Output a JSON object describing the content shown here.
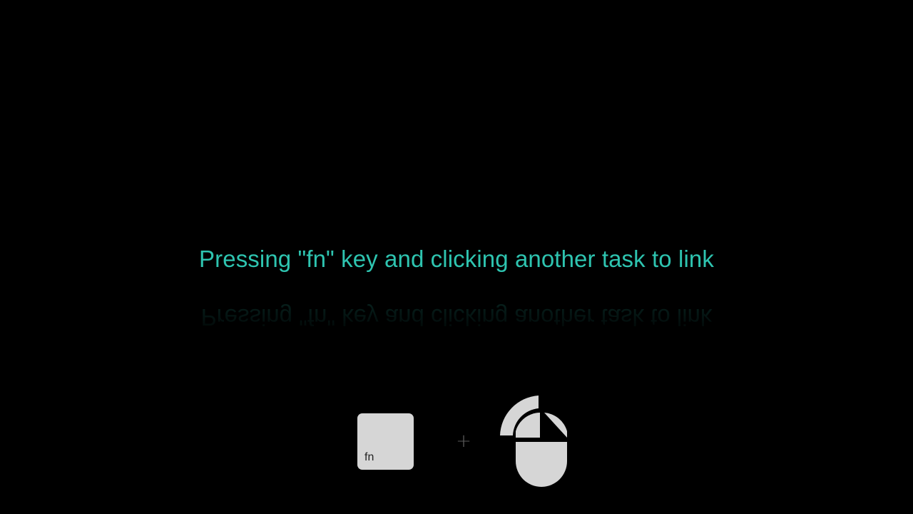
{
  "caption": {
    "text": "Pressing \"fn\" key and clicking another task to link",
    "color": "#2ec4b0"
  },
  "shortcut": {
    "key_label": "fn",
    "key_color": "#d6d6d6",
    "plus_symbol": "+",
    "pointer_icon": "mouse-left-click-icon"
  }
}
